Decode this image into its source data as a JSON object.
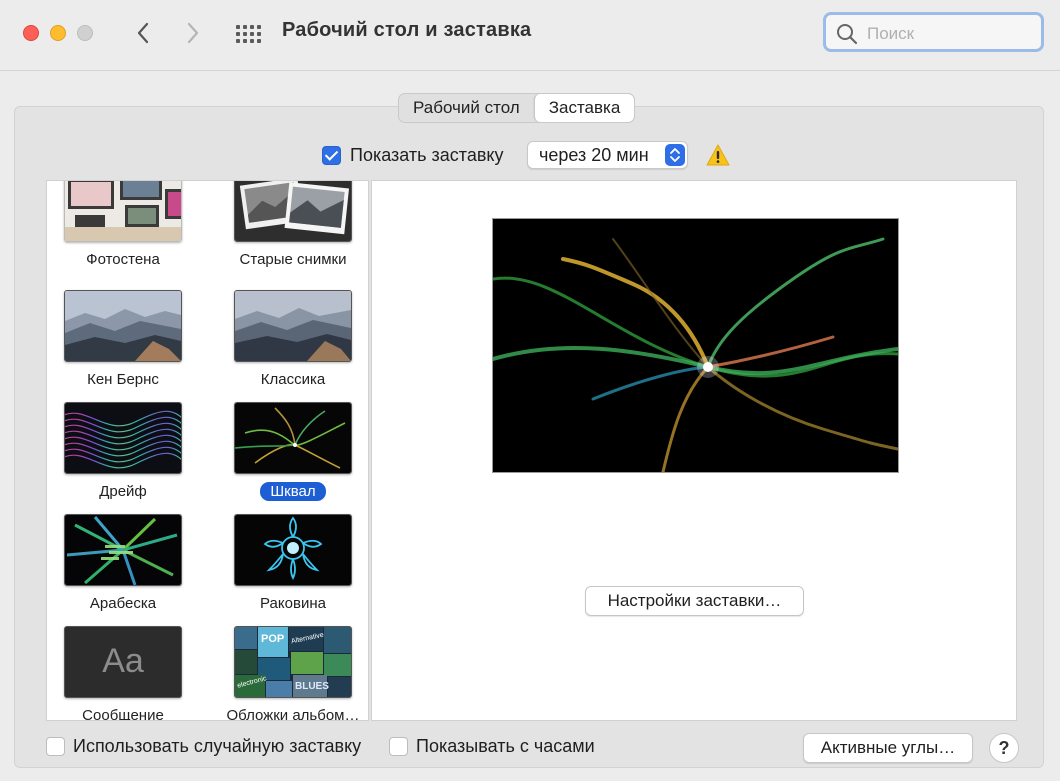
{
  "window": {
    "title": "Рабочий стол и заставка",
    "search_placeholder": "Поиск"
  },
  "tabs": [
    {
      "label": "Рабочий стол",
      "active": false
    },
    {
      "label": "Заставка",
      "active": true
    }
  ],
  "show_screensaver": {
    "label": "Показать заставку",
    "checked": true,
    "delay_value": "через 20 мин"
  },
  "savers": [
    {
      "label": "Фотостена",
      "icon": "photo-wall-thumbnail"
    },
    {
      "label": "Старые снимки",
      "icon": "vintage-prints-thumbnail"
    },
    {
      "label": "Кен Бернс",
      "icon": "ken-burns-thumbnail"
    },
    {
      "label": "Классика",
      "icon": "classic-thumbnail"
    },
    {
      "label": "Дрейф",
      "icon": "drift-thumbnail"
    },
    {
      "label": "Шквал",
      "icon": "flurry-thumbnail",
      "selected": true
    },
    {
      "label": "Арабеска",
      "icon": "arabesque-thumbnail"
    },
    {
      "label": "Раковина",
      "icon": "shell-thumbnail"
    },
    {
      "label": "Сообщение",
      "icon": "message-thumbnail",
      "thumb_text": "Aa"
    },
    {
      "label": "Обложки альбом…",
      "icon": "album-artwork-thumbnail"
    }
  ],
  "album_thumb_words": [
    "POP",
    "Alternative",
    "electronic",
    "BLUES"
  ],
  "preview": {
    "settings_button": "Настройки заставки…"
  },
  "footer": {
    "random_label": "Использовать случайную заставку",
    "random_checked": false,
    "clock_label": "Показывать с часами",
    "clock_checked": false,
    "hot_corners_button": "Активные углы…",
    "help_label": "?"
  },
  "colors": {
    "accent": "#2e6ee6",
    "selection": "#1d5ed4"
  }
}
